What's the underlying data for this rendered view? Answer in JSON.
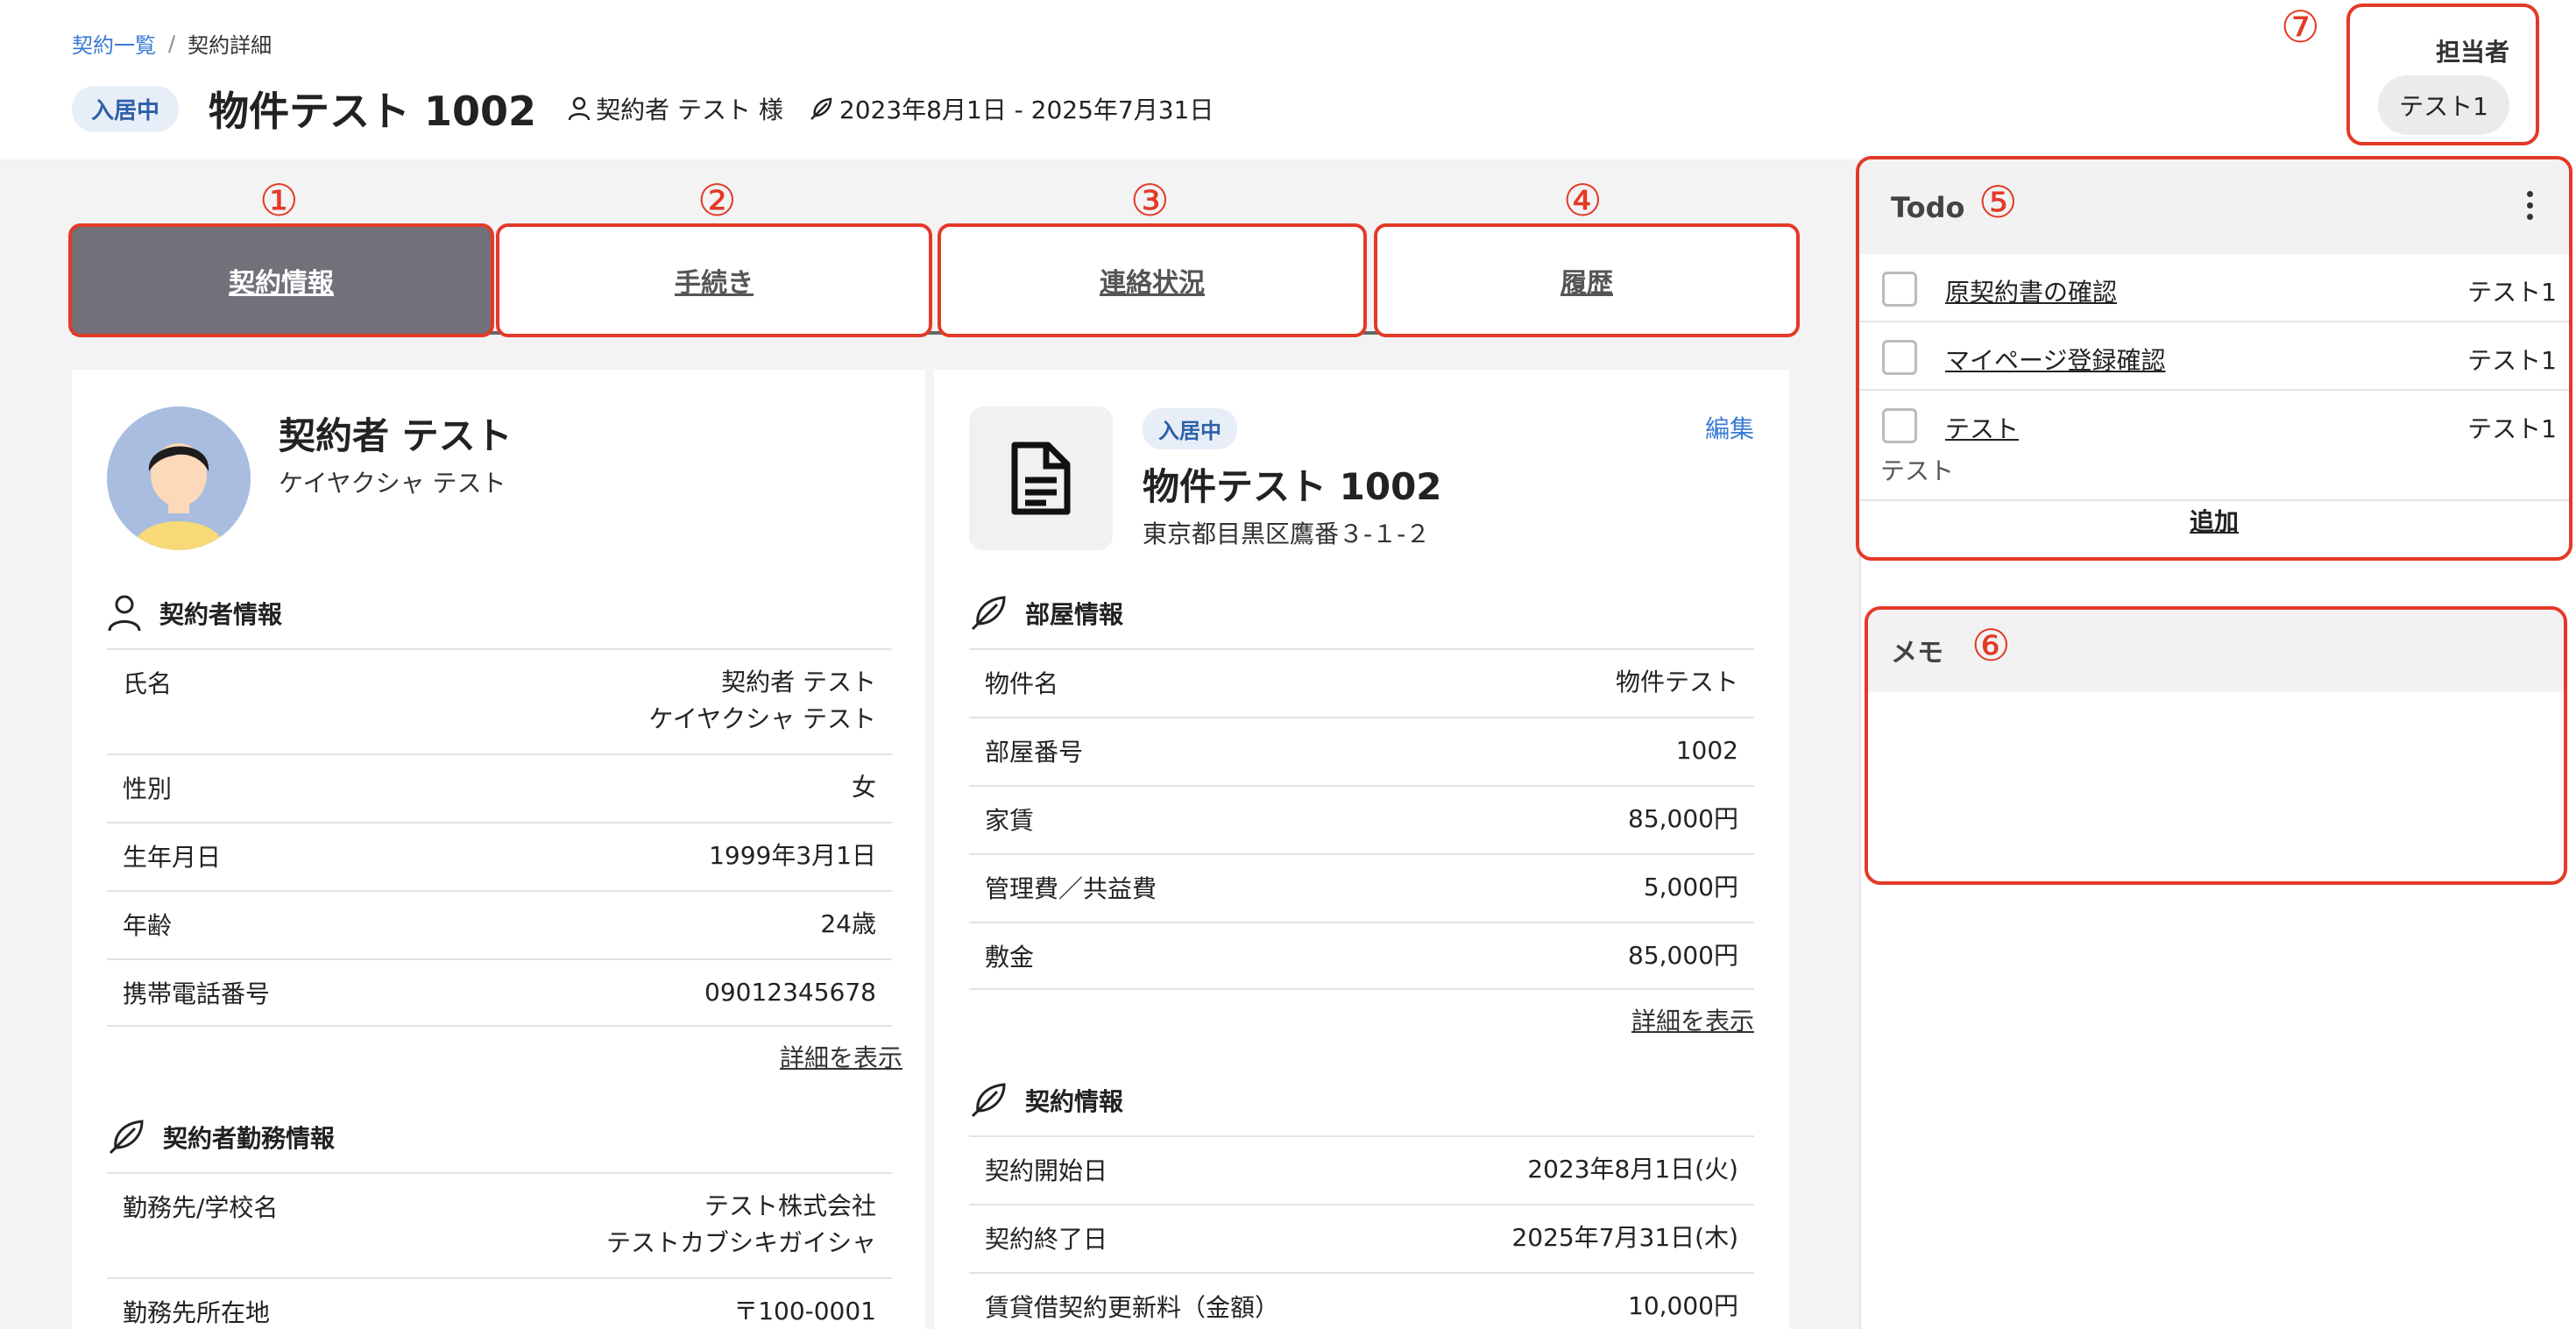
{
  "breadcrumb": {
    "parent": "契約一覧",
    "separator": "/",
    "current": "契約詳細"
  },
  "header": {
    "status": "入居中",
    "title": "物件テスト 1002",
    "contractor": "契約者 テスト 様",
    "period": "2023年8月1日 - 2025年7月31日"
  },
  "assignee": {
    "label": "担当者",
    "name": "テスト1"
  },
  "annotations": {
    "a1": "①",
    "a2": "②",
    "a3": "③",
    "a4": "④",
    "a5": "⑤",
    "a6": "⑥",
    "a7": "⑦"
  },
  "tabs": [
    {
      "label": "契約情報",
      "active": true
    },
    {
      "label": "手続き"
    },
    {
      "label": "連絡状況"
    },
    {
      "label": "履歴"
    }
  ],
  "contractor_card": {
    "name": "契約者 テスト",
    "kana": "ケイヤクシャ テスト",
    "section_title": "契約者情報",
    "rows": [
      {
        "key": "氏名",
        "value": "契約者 テスト",
        "value2": "ケイヤクシャ テスト"
      },
      {
        "key": "性別",
        "value": "女"
      },
      {
        "key": "生年月日",
        "value": "1999年3月1日"
      },
      {
        "key": "年齢",
        "value": "24歳"
      },
      {
        "key": "携帯電話番号",
        "value": "09012345678"
      }
    ],
    "detail_link": "詳細を表示",
    "work_section_title": "契約者勤務情報",
    "work_rows": [
      {
        "key": "勤務先/学校名",
        "value": "テスト株式会社",
        "value2": "テストカブシキガイシャ"
      },
      {
        "key": "勤務先所在地",
        "value": "〒100-0001"
      }
    ]
  },
  "property_card": {
    "status": "入居中",
    "edit": "編集",
    "name": "物件テスト 1002",
    "address": "東京都目黒区鷹番３-１-２",
    "room_section_title": "部屋情報",
    "room_rows": [
      {
        "key": "物件名",
        "value": "物件テスト"
      },
      {
        "key": "部屋番号",
        "value": "1002"
      },
      {
        "key": "家賃",
        "value": "85,000円"
      },
      {
        "key": "管理費／共益費",
        "value": "5,000円"
      },
      {
        "key": "敷金",
        "value": "85,000円"
      }
    ],
    "detail_link": "詳細を表示",
    "contract_section_title": "契約情報",
    "contract_rows": [
      {
        "key": "契約開始日",
        "value": "2023年8月1日(火)"
      },
      {
        "key": "契約終了日",
        "value": "2025年7月31日(木)"
      },
      {
        "key": "賃貸借契約更新料（金額）",
        "value": "10,000円"
      }
    ]
  },
  "todo": {
    "title": "Todo",
    "items": [
      {
        "label": "原契約書の確認",
        "assignee": "テスト1"
      },
      {
        "label": "マイページ登録確認",
        "assignee": "テスト1"
      },
      {
        "label": "テスト",
        "assignee": "テスト1",
        "note": "テスト"
      }
    ],
    "add": "追加"
  },
  "memo": {
    "title": "メモ"
  },
  "colors": {
    "annotation": "#e33a27",
    "accent": "#3a7bd5",
    "active_tab": "#727079"
  }
}
